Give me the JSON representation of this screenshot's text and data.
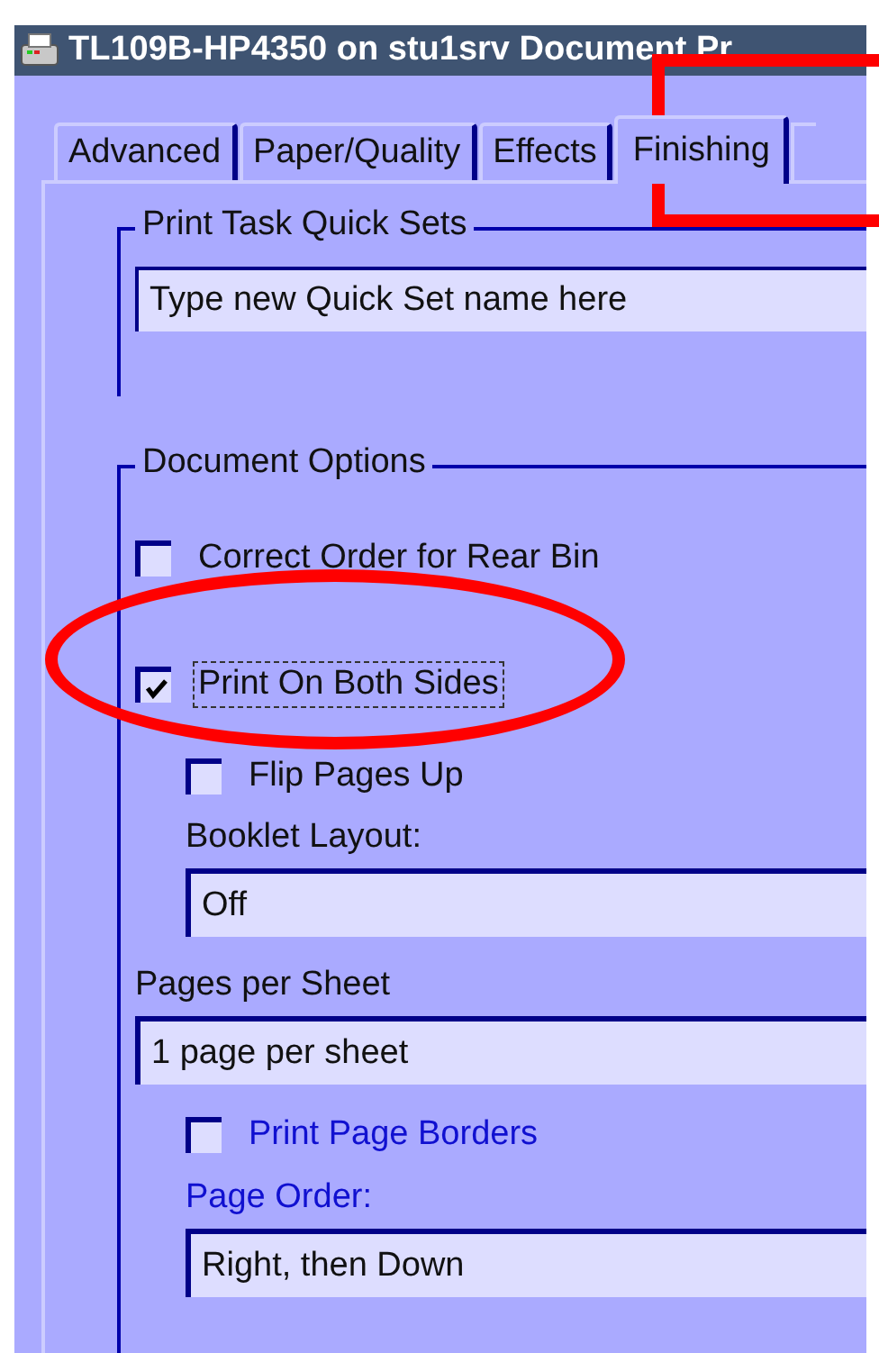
{
  "window": {
    "title": "TL109B-HP4350 on stu1srv Document Pr"
  },
  "tabs": [
    {
      "label": "Advanced",
      "selected": false
    },
    {
      "label": "Paper/Quality",
      "selected": false
    },
    {
      "label": "Effects",
      "selected": false
    },
    {
      "label": "Finishing",
      "selected": true
    }
  ],
  "quick_sets": {
    "title": "Print Task Quick Sets",
    "value": "Type new Quick Set name here"
  },
  "document_options": {
    "title": "Document Options",
    "items": [
      {
        "kind": "checkbox",
        "label": "Correct Order for Rear Bin",
        "checked": false,
        "disabled": false,
        "indented": false
      },
      {
        "kind": "checkbox",
        "label": "Print On Both Sides",
        "checked": true,
        "disabled": false,
        "indented": false,
        "focused": true
      },
      {
        "kind": "checkbox",
        "label": "Flip Pages Up",
        "checked": false,
        "disabled": false,
        "indented": true
      },
      {
        "kind": "label",
        "label": "Booklet Layout:",
        "disabled": false,
        "indented": true
      },
      {
        "kind": "dropdown",
        "value": "Off",
        "disabled": false,
        "indented": true
      },
      {
        "kind": "label",
        "label": "Pages per Sheet",
        "disabled": false,
        "indented": false
      },
      {
        "kind": "dropdown",
        "value": "1 page per sheet",
        "disabled": false,
        "indented": false
      },
      {
        "kind": "checkbox",
        "label": "Print Page Borders",
        "checked": false,
        "disabled": true,
        "indented": true
      },
      {
        "kind": "label",
        "label": "Page Order:",
        "disabled": true,
        "indented": true
      },
      {
        "kind": "dropdown",
        "value": "Right, then Down",
        "disabled": false,
        "indented": true
      }
    ]
  },
  "annotations": [
    {
      "kind": "rectangle"
    },
    {
      "kind": "ellipse"
    }
  ]
}
